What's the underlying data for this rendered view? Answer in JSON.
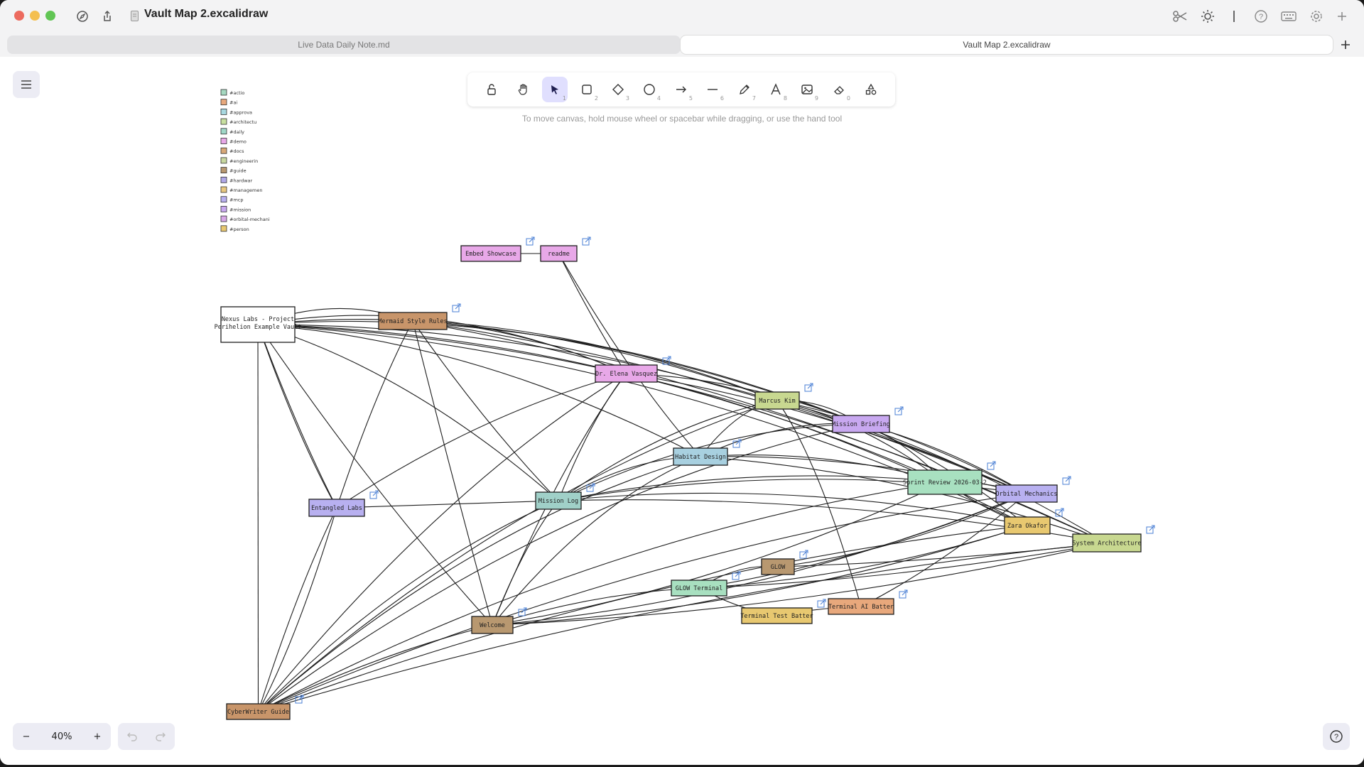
{
  "window": {
    "title": "Vault Map 2.excalidraw",
    "traffic_lights": [
      "#ec6a5e",
      "#f4bf4f",
      "#61c554"
    ]
  },
  "tabs": [
    {
      "label": "Live Data Daily Note.md",
      "active": false
    },
    {
      "label": "Vault Map 2.excalidraw",
      "active": true
    }
  ],
  "toolbar": {
    "tools": [
      {
        "name": "lock",
        "shortcut": ""
      },
      {
        "name": "hand",
        "shortcut": ""
      },
      {
        "name": "selection",
        "shortcut": "1"
      },
      {
        "name": "rectangle",
        "shortcut": "2"
      },
      {
        "name": "diamond",
        "shortcut": "3"
      },
      {
        "name": "ellipse",
        "shortcut": "4"
      },
      {
        "name": "arrow",
        "shortcut": "5"
      },
      {
        "name": "line",
        "shortcut": "6"
      },
      {
        "name": "draw",
        "shortcut": "7"
      },
      {
        "name": "text",
        "shortcut": "8"
      },
      {
        "name": "image",
        "shortcut": "9"
      },
      {
        "name": "eraser",
        "shortcut": "0"
      },
      {
        "name": "more-shapes",
        "shortcut": ""
      }
    ],
    "active_tool": "selection"
  },
  "canvas_hint": "To move canvas, hold mouse wheel or spacebar while dragging, or use the hand tool",
  "zoom": {
    "level": "40%",
    "minus": "−",
    "plus": "+"
  },
  "legend": [
    {
      "tag": "#actio",
      "color": "#a5d8c0"
    },
    {
      "tag": "#ai",
      "color": "#e8a87c"
    },
    {
      "tag": "#approva",
      "color": "#a8d8e0"
    },
    {
      "tag": "#architectu",
      "color": "#c8e0a0"
    },
    {
      "tag": "#daily",
      "color": "#a0d8c8"
    },
    {
      "tag": "#demo",
      "color": "#e8a8e8"
    },
    {
      "tag": "#docs",
      "color": "#d8a878"
    },
    {
      "tag": "#engineerin",
      "color": "#c8d8a0"
    },
    {
      "tag": "#guide",
      "color": "#b89870"
    },
    {
      "tag": "#hardwar",
      "color": "#b0a8e8"
    },
    {
      "tag": "#managemen",
      "color": "#e8c880"
    },
    {
      "tag": "#mcp",
      "color": "#b8b0f0"
    },
    {
      "tag": "#mission",
      "color": "#c8a8f0"
    },
    {
      "tag": "#orbital-mechani",
      "color": "#d8a8e8"
    },
    {
      "tag": "#person",
      "color": "#e8c870"
    }
  ],
  "nodes": [
    {
      "label": "Nexus Labs - Project Perihelion Example Vault",
      "lines": [
        "Nexus Labs - Project",
        "Perihelion Example Vault"
      ],
      "color": "#ffffff"
    },
    {
      "label": "Embed Showcase",
      "color": "#e8a8e8"
    },
    {
      "label": "readme",
      "color": "#e8a8e8"
    },
    {
      "label": "Mermaid Style Rules",
      "color": "#c8956a"
    },
    {
      "label": "Dr. Elena Vasquez",
      "color": "#e8a8e8"
    },
    {
      "label": "Marcus Kim",
      "color": "#c8d890"
    },
    {
      "label": "Mission Briefing",
      "color": "#c8a8f0"
    },
    {
      "label": "Habitat Design",
      "color": "#a8d0e0"
    },
    {
      "label": "Sprint Review 2026-03-2",
      "color": "#a8e0c0"
    },
    {
      "label": "Orbital Mechanics",
      "color": "#b8b0f0"
    },
    {
      "label": "Zara Okafor",
      "color": "#e8c870"
    },
    {
      "label": "System Architecture",
      "color": "#c8d890"
    },
    {
      "label": "Entangled Labs",
      "color": "#b8b0f0"
    },
    {
      "label": "Mission Log",
      "color": "#a0d0c8"
    },
    {
      "label": "GLOW",
      "color": "#b89870"
    },
    {
      "label": "GLOW Terminal",
      "color": "#a8e0c0"
    },
    {
      "label": "Terminal Test Batter",
      "color": "#e8c870"
    },
    {
      "label": "Terminal AI Batter",
      "color": "#e8a87c"
    },
    {
      "label": "Welcome",
      "color": "#b89870"
    },
    {
      "label": "CyberWriter Guide",
      "color": "#c8956a"
    }
  ]
}
